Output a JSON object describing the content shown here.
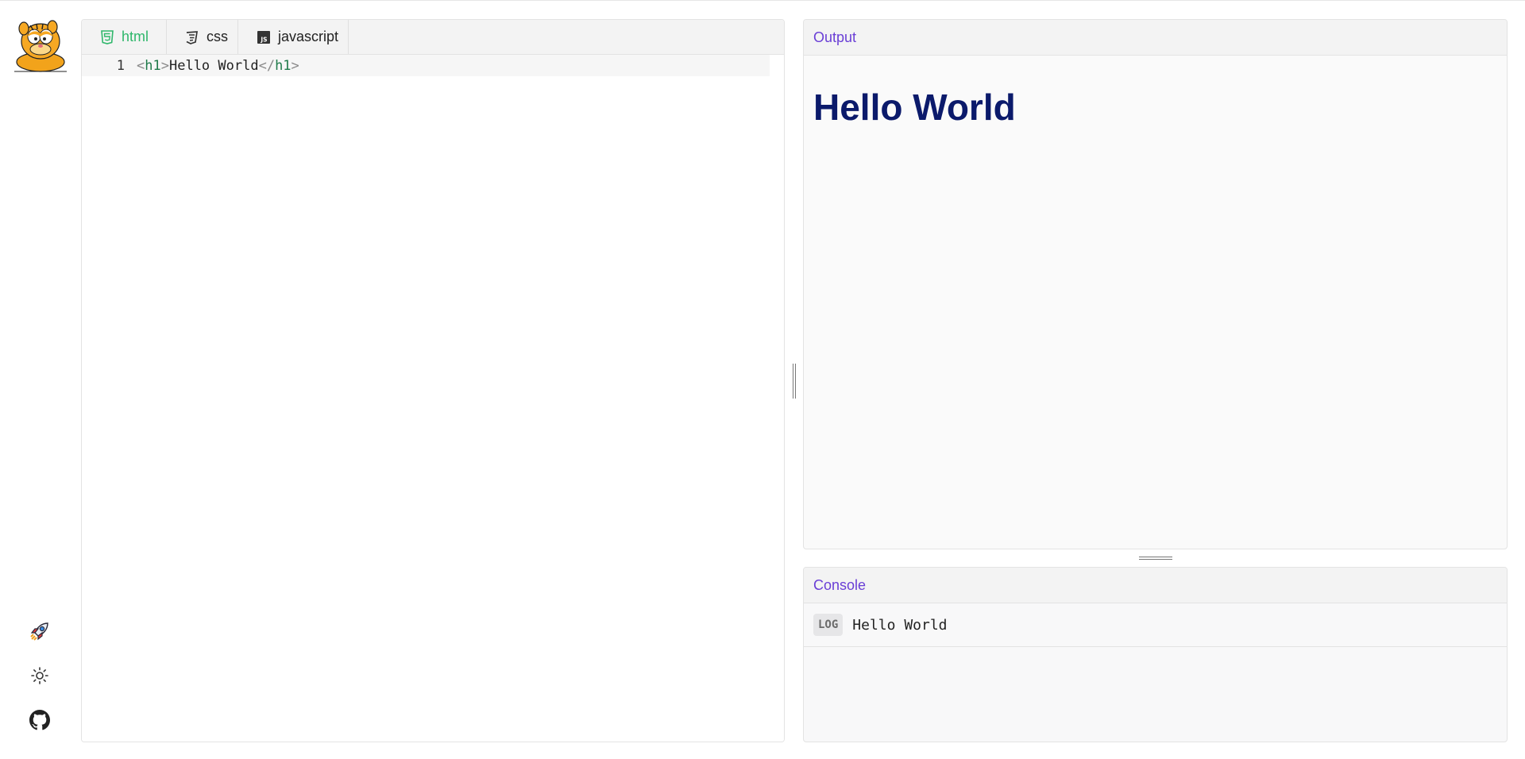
{
  "editor": {
    "tabs": [
      {
        "label": "html",
        "icon": "html5-icon",
        "active": true
      },
      {
        "label": "css",
        "icon": "css3-icon",
        "active": false
      },
      {
        "label": "javascript",
        "icon": "js-icon",
        "active": false
      }
    ],
    "line_number": "1",
    "code": {
      "open_bracket": "<",
      "open_tag": "h1",
      "close_bracket": ">",
      "content": "Hello World",
      "close_open_bracket": "</",
      "close_tag": "h1",
      "close_end_bracket": ">"
    }
  },
  "output": {
    "title": "Output",
    "heading": "Hello World"
  },
  "console": {
    "title": "Console",
    "entries": [
      {
        "level": "LOG",
        "message": "Hello World"
      }
    ]
  },
  "sidebar": {
    "icons": [
      "garfield-logo",
      "rocket-icon",
      "sun-icon",
      "github-icon"
    ]
  },
  "colors": {
    "accent": "#6a3fd6",
    "active_tab": "#2fb76b",
    "heading": "#0b1a6b",
    "tag": "#1f7a4a"
  }
}
